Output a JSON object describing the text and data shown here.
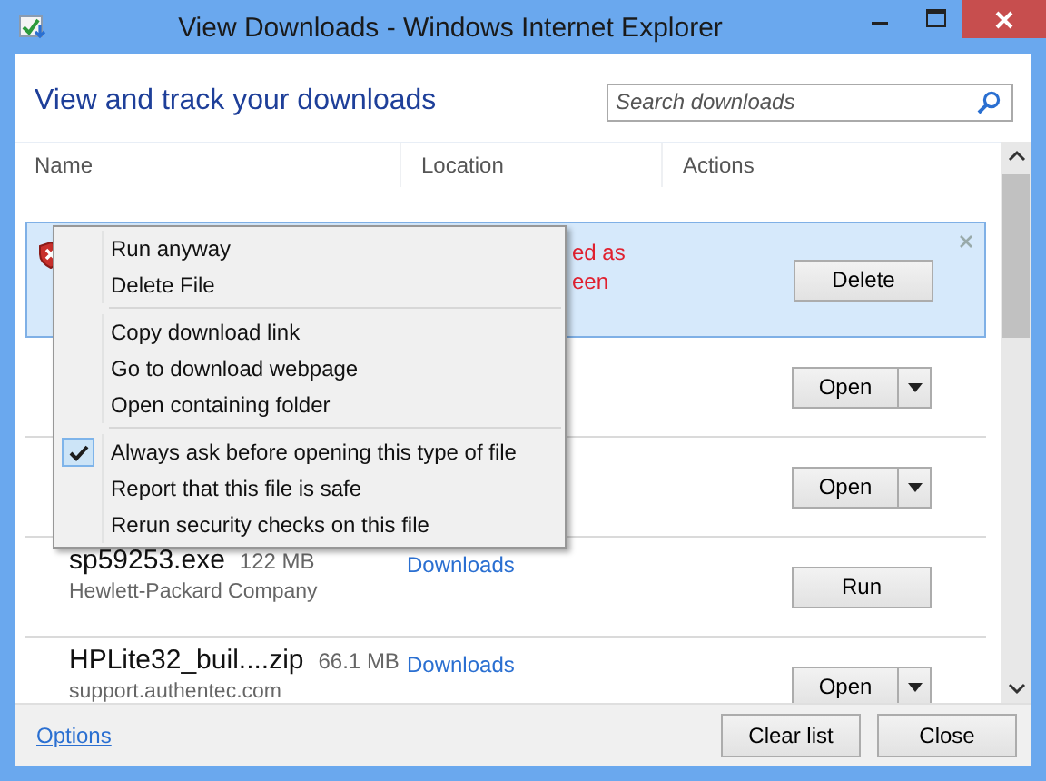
{
  "window": {
    "title": "View Downloads - Windows Internet Explorer"
  },
  "heading": "View and track your downloads",
  "search": {
    "placeholder": "Search downloads"
  },
  "columns": [
    "Name",
    "Location",
    "Actions"
  ],
  "downloads": [
    {
      "kind": "blocked",
      "selected": true,
      "warning": [
        "ed as",
        "een"
      ],
      "action": "Delete",
      "split": false
    },
    {
      "kind": "hidden",
      "selected": false,
      "action": "Open",
      "split": true
    },
    {
      "kind": "hidden",
      "selected": false,
      "action": "Open",
      "split": true
    },
    {
      "kind": "file",
      "selected": false,
      "name": "sp59253.exe",
      "size": "122 MB",
      "publisher": "Hewlett-Packard Company",
      "location": "Downloads",
      "action": "Run",
      "split": false
    },
    {
      "kind": "file",
      "selected": false,
      "name": "HPLite32_buil....zip",
      "size": "66.1 MB",
      "publisher": "support.authentec.com",
      "location": "Downloads",
      "action": "Open",
      "split": true
    }
  ],
  "context_menu": [
    {
      "kind": "item",
      "label": "Run anyway",
      "checked": false
    },
    {
      "kind": "item",
      "label": "Delete File",
      "checked": false
    },
    {
      "kind": "separator"
    },
    {
      "kind": "item",
      "label": "Copy download link",
      "checked": false
    },
    {
      "kind": "item",
      "label": "Go to download webpage",
      "checked": false
    },
    {
      "kind": "item",
      "label": "Open containing folder",
      "checked": false
    },
    {
      "kind": "separator"
    },
    {
      "kind": "item",
      "label": "Always ask before opening this type of file",
      "checked": true
    },
    {
      "kind": "item",
      "label": "Report that this file is safe",
      "checked": false
    },
    {
      "kind": "item",
      "label": "Rerun security checks on this file",
      "checked": false
    }
  ],
  "footer": {
    "options": "Options",
    "buttons": [
      "Clear list",
      "Close"
    ]
  }
}
